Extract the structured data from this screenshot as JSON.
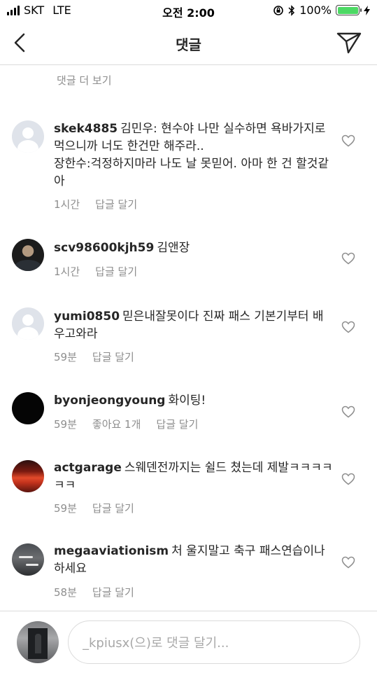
{
  "status_bar": {
    "carrier": "SKT",
    "network": "LTE",
    "time": "오전 2:00",
    "battery": "100%",
    "battery_level": 1.0
  },
  "nav": {
    "title": "댓글",
    "back_icon": "chevron-left-icon",
    "send_icon": "paper-plane-icon"
  },
  "more_comments": "댓글 더 보기",
  "comments": [
    {
      "username": "skek4885",
      "text": "김민우: 현수야 나만 실수하면 욕바가지로 먹으니까 너도 한건만 해주라..",
      "text2": "장한수:걱정하지마라 나도 날 못믿어. 아마 한 건 할것같아",
      "time": "1시간",
      "reply": "답글 달기"
    },
    {
      "username": "scv98600kjh59",
      "text": "김앤장",
      "time": "1시간",
      "reply": "답글 달기"
    },
    {
      "username": "yumi0850",
      "text": "믿은내잘못이다 진짜 패스 기본기부터 배우고와라",
      "time": "59분",
      "reply": "답글 달기"
    },
    {
      "username": "byonjeongyoung",
      "text": "화이팅!",
      "time": "59분",
      "likes": "좋아요 1개",
      "reply": "답글 달기"
    },
    {
      "username": "actgarage",
      "text": "스웨덴전까지는 쉴드 쳤는데 제발ㅋㅋㅋㅋㅋㅋ",
      "time": "59분",
      "reply": "답글 달기"
    },
    {
      "username": "megaaviationism",
      "text": "처 울지말고 축구 패스연습이나 하세요",
      "time": "58분",
      "reply": "답글 달기"
    }
  ],
  "composer": {
    "placeholder": "_kpiusx(으)로 댓글 달기..."
  }
}
